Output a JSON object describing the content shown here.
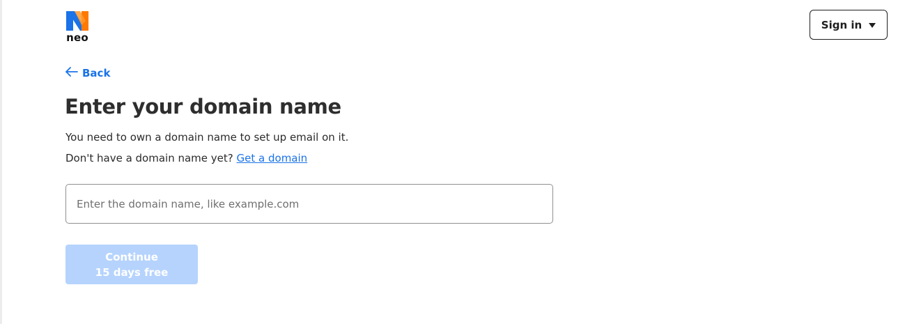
{
  "brand": {
    "name": "neo",
    "logo_icon": "neo-logo-icon",
    "colors": {
      "blue": "#1a73e8",
      "orange": "#ff7a00"
    }
  },
  "header": {
    "signin_label": "Sign in",
    "signin_icon": "caret-down-icon"
  },
  "nav": {
    "back_label": "Back",
    "back_icon": "arrow-left-icon"
  },
  "main": {
    "title": "Enter your domain name",
    "description": "You need to own a domain name to set up email on it.",
    "no_domain_prompt": "Don't have a domain name yet?",
    "get_domain_link": "Get a domain",
    "domain_input": {
      "placeholder": "Enter the domain name, like example.com",
      "value": ""
    },
    "continue_button": {
      "line1": "Continue",
      "line2": "15 days free",
      "state": "disabled",
      "bg_color": "#b5d3fd"
    }
  }
}
